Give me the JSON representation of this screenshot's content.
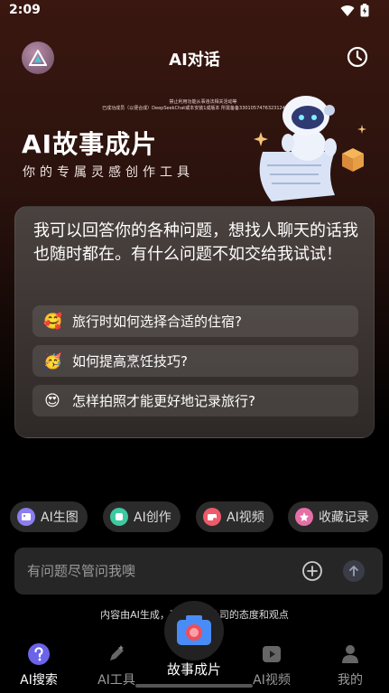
{
  "status_bar": {
    "time": "2:09"
  },
  "header": {
    "title": "AI对话"
  },
  "banner": {
    "disclaimer_line1": "禁止利用功能从事违法相关活动等",
    "disclaimer_line2": "已成功成员（以便合成）DeepSeekChat或本安装1成版本 所需备备330105747632312406172号",
    "title": "AI故事成片",
    "subtitle": "你的专属灵感创作工具"
  },
  "chat": {
    "intro": "我可以回答你的各种问题，想找人聊天的话我也随时都在。有什么问题不如交给我试试！",
    "suggestions": [
      {
        "emoji": "🥰",
        "text": "旅行时如何选择合适的住宿?"
      },
      {
        "emoji": "🥳",
        "text": "如何提高烹饪技巧?"
      },
      {
        "emoji": "😍",
        "text": "怎样拍照才能更好地记录旅行?"
      }
    ]
  },
  "chips": [
    {
      "label": "AI生图",
      "icon": "image-gen-icon",
      "color": "#8b7ef0"
    },
    {
      "label": "AI创作",
      "icon": "creation-icon",
      "color": "#3ec9a0"
    },
    {
      "label": "AI视频",
      "icon": "video-icon",
      "color": "#ef5a6a"
    },
    {
      "label": "收藏记录",
      "icon": "star-icon",
      "color": "#e76fa8"
    }
  ],
  "input": {
    "placeholder": "有问题尽管问我噢"
  },
  "note": "内容由AI生成，不代表本公司的态度和观点",
  "nav": [
    {
      "label": "AI搜索",
      "icon": "question-icon"
    },
    {
      "label": "AI工具",
      "icon": "pen-icon"
    },
    {
      "label": "故事成片",
      "icon": "camera-icon"
    },
    {
      "label": "AI视频",
      "icon": "play-icon"
    },
    {
      "label": "我的",
      "icon": "user-icon"
    }
  ]
}
